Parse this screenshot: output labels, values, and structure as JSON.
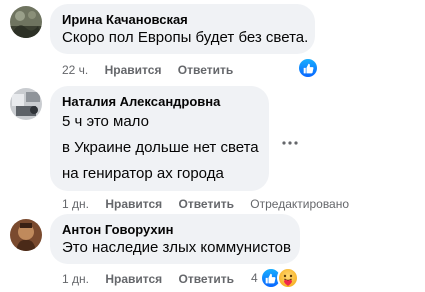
{
  "comments": [
    {
      "author": "Ирина Качановская",
      "lines": [
        "Скоро пол Европы будет без света."
      ],
      "time": "22 ч.",
      "like_label": "Нравится",
      "reply_label": "Ответить",
      "reaction_count": ""
    },
    {
      "author": "Наталия Александровна",
      "lines": [
        "5 ч это мало",
        "в Украине дольше нет света",
        "на гениратор ах города"
      ],
      "time": "1 дн.",
      "like_label": "Нравится",
      "reply_label": "Ответить",
      "edited_label": "Отредактировано"
    },
    {
      "author": "Антон Говорухин",
      "lines": [
        "Это наследие злых коммунистов"
      ],
      "time": "1 дн.",
      "like_label": "Нравится",
      "reply_label": "Ответить",
      "reaction_count": "4"
    }
  ],
  "icons": {
    "more": "more-options-icon",
    "like": "like-reaction-icon",
    "care": "care-reaction-icon"
  },
  "colors": {
    "bubble": "#f0f2f5",
    "meta": "#65676b",
    "like_blue": "#0866ff"
  }
}
